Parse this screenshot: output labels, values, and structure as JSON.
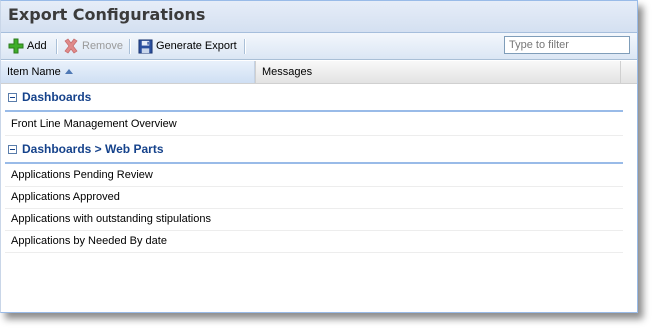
{
  "window": {
    "title": "Export Configurations"
  },
  "toolbar": {
    "add_label": "Add",
    "remove_label": "Remove",
    "generate_label": "Generate Export",
    "filter_placeholder": "Type to filter"
  },
  "grid": {
    "columns": [
      "Item Name",
      "Messages"
    ],
    "sorted_column": "Item Name",
    "sort_direction": "ascending"
  },
  "groups": [
    {
      "label": "Dashboards",
      "rows": [
        "Front Line Management Overview"
      ]
    },
    {
      "label": "Dashboards > Web Parts",
      "rows": [
        "Applications Pending Review",
        "Applications Approved",
        "Applications with outstanding stipulations",
        "Applications by Needed By date"
      ]
    }
  ],
  "colors": {
    "accent": "#15428b",
    "border": "#99bbe8"
  }
}
